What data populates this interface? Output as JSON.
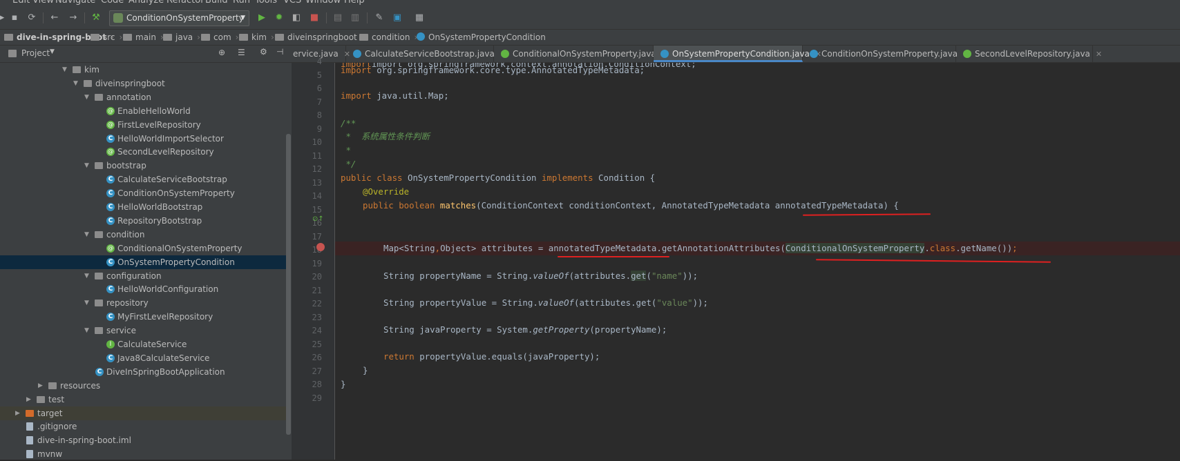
{
  "menu": [
    "Edit",
    "View",
    "Navigate",
    "Code",
    "Analyze",
    "Refactor",
    "Build",
    "Run",
    "Tools",
    "VCS",
    "Window",
    "Help"
  ],
  "toolbar": {
    "run_config": "ConditionOnSystemProperty",
    "icons": [
      "save-icon",
      "sync-icon",
      "back-arrow-icon",
      "forward-arrow-icon",
      "build-hammer-icon",
      "run-icon",
      "debug-icon",
      "coverage-icon",
      "stop-icon",
      "project-structure-icon",
      "sdk-icon",
      "settings-wrench-icon",
      "structure-icon",
      "terminal-icon"
    ]
  },
  "breadcrumb": [
    "dive-in-spring-boot",
    "src",
    "main",
    "java",
    "com",
    "kim",
    "diveinspringboot",
    "condition",
    "OnSystemPropertyCondition"
  ],
  "project_panel": {
    "title": "Project"
  },
  "tree": [
    {
      "label": "kim",
      "depth": 0,
      "type": "folder",
      "open": true
    },
    {
      "label": "diveinspringboot",
      "depth": 1,
      "type": "folder",
      "open": true
    },
    {
      "label": "annotation",
      "depth": 2,
      "type": "folder",
      "open": true
    },
    {
      "label": "EnableHelloWorld",
      "depth": 3,
      "type": "annot"
    },
    {
      "label": "FirstLevelRepository",
      "depth": 3,
      "type": "annot"
    },
    {
      "label": "HelloWorldImportSelector",
      "depth": 3,
      "type": "class"
    },
    {
      "label": "SecondLevelRepository",
      "depth": 3,
      "type": "annot"
    },
    {
      "label": "bootstrap",
      "depth": 2,
      "type": "folder",
      "open": true
    },
    {
      "label": "CalculateServiceBootstrap",
      "depth": 3,
      "type": "class"
    },
    {
      "label": "ConditionOnSystemProperty",
      "depth": 3,
      "type": "class"
    },
    {
      "label": "HelloWorldBootstrap",
      "depth": 3,
      "type": "class"
    },
    {
      "label": "RepositoryBootstrap",
      "depth": 3,
      "type": "class"
    },
    {
      "label": "condition",
      "depth": 2,
      "type": "folder",
      "open": true
    },
    {
      "label": "ConditionalOnSystemProperty",
      "depth": 3,
      "type": "annot"
    },
    {
      "label": "OnSystemPropertyCondition",
      "depth": 3,
      "type": "class",
      "selected": true
    },
    {
      "label": "configuration",
      "depth": 2,
      "type": "folder",
      "open": true
    },
    {
      "label": "HelloWorldConfiguration",
      "depth": 3,
      "type": "class"
    },
    {
      "label": "repository",
      "depth": 2,
      "type": "folder",
      "open": true
    },
    {
      "label": "MyFirstLevelRepository",
      "depth": 3,
      "type": "class"
    },
    {
      "label": "service",
      "depth": 2,
      "type": "folder",
      "open": true
    },
    {
      "label": "CalculateService",
      "depth": 3,
      "type": "intf"
    },
    {
      "label": "Java8CalculateService",
      "depth": 3,
      "type": "class"
    },
    {
      "label": "DiveInSpringBootApplication",
      "depth": 2,
      "type": "class"
    },
    {
      "label": "resources",
      "depth": -1,
      "type": "folder",
      "open": false
    },
    {
      "label": "test",
      "depth": -2,
      "type": "folder",
      "open": false
    },
    {
      "label": "target",
      "depth": -3,
      "type": "folder-orange",
      "open": false,
      "highlight": true
    },
    {
      "label": ".gitignore",
      "depth": -3,
      "type": "file"
    },
    {
      "label": "dive-in-spring-boot.iml",
      "depth": -3,
      "type": "file"
    },
    {
      "label": "mvnw",
      "depth": -3,
      "type": "file"
    }
  ],
  "tabs": [
    {
      "label": "ervice.java",
      "color": "#3592c4"
    },
    {
      "label": "CalculateServiceBootstrap.java",
      "color": "#3592c4"
    },
    {
      "label": "ConditionalOnSystemProperty.java",
      "color": "#62b543"
    },
    {
      "label": "OnSystemPropertyCondition.java",
      "color": "#3592c4",
      "active": true
    },
    {
      "label": "ConditionOnSystemProperty.java",
      "color": "#3592c4"
    },
    {
      "label": "SecondLevelRepository.java",
      "color": "#62b543"
    }
  ],
  "line_numbers": [
    "4",
    "5",
    "6",
    "7",
    "8",
    "9",
    "10",
    "11",
    "12",
    "13",
    "14",
    "15",
    "16",
    "17",
    "18",
    "19",
    "20",
    "21",
    "22",
    "23",
    "24",
    "25",
    "26",
    "27",
    "28",
    "29"
  ],
  "code": {
    "l4": "import org.springframework.context.annotation.ConditionContext;",
    "l5_kw": "import",
    "l5": " org.springframework.core.type.AnnotatedTypeMetadata;",
    "l7_kw": "import",
    "l7": " java.util.Map;",
    "l9": "/**",
    "l10": " *  系统属性条件判断",
    "l11": " *",
    "l12": " */",
    "l13_kw": "public class",
    "l13_name": " OnSystemPropertyCondition ",
    "l13_kw2": "implements",
    "l13_rest": " Condition {",
    "l14": "@Override",
    "l15_kw": "public boolean",
    "l15_m": " matches",
    "l15_rest": "(ConditionContext conditionContext, AnnotatedTypeMetadata annotatedTypeMetadata) {",
    "l17_a": "Map<String",
    "l17_b": ",",
    "l17_c": "Object> attributes = annotatedTypeMetadata.getAnnotationAttributes(",
    "l17_d": "ConditionalOnSystemProperty",
    "l17_e": ".",
    "l17_f": "class",
    "l17_g": ".getName())",
    "l17_h": ";",
    "l19_a": "String propertyName = String.",
    "l19_b": "valueOf",
    "l19_c": "(attributes.",
    "l19_d": "get",
    "l19_e": "(",
    "l19_f": "\"name\"",
    "l19_g": "));",
    "l21_a": "String propertyValue = String.",
    "l21_b": "valueOf",
    "l21_c": "(attributes.get(",
    "l21_d": "\"value\"",
    "l21_e": "));",
    "l23_a": "String javaProperty = System.",
    "l23_b": "getProperty",
    "l23_c": "(propertyName);",
    "l25_kw": "return",
    "l25": " propertyValue.equals(javaProperty);",
    "l26": "}",
    "l27": "}"
  }
}
